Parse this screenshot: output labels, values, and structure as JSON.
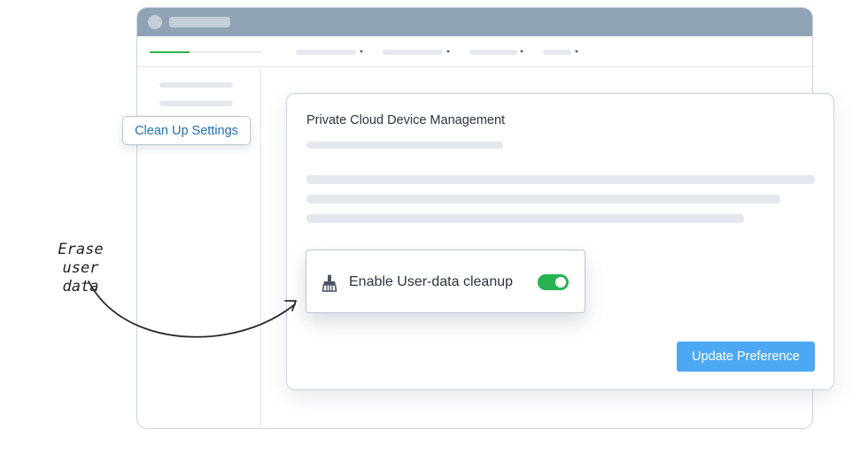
{
  "tag": {
    "label": "Clean Up Settings"
  },
  "card": {
    "title": "Private Cloud Device Management",
    "update_button_label": "Update Preference"
  },
  "toggle": {
    "label": "Enable User-data cleanup",
    "enabled": true,
    "icon": "broom-icon"
  },
  "annotation": {
    "line1": "Erase",
    "line2": "user data"
  },
  "colors": {
    "accent": "#4ca8f2",
    "toggle_on": "#27b151",
    "progress": "#2bb34a",
    "titlebar": "#90a3b6",
    "link": "#1f6fb0"
  }
}
